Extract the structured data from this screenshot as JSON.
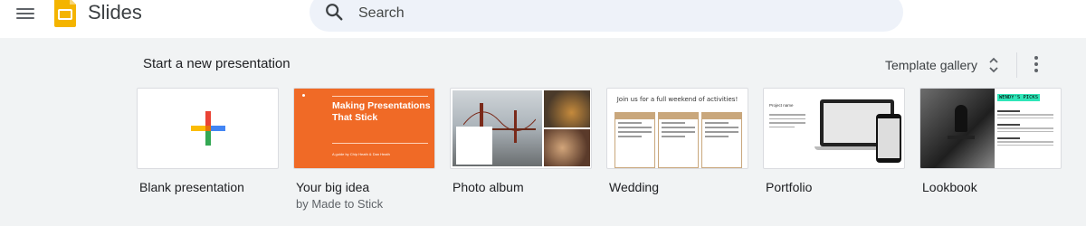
{
  "app": {
    "name": "Slides"
  },
  "search": {
    "placeholder": "Search"
  },
  "start": {
    "section_title": "Start a new presentation",
    "template_gallery_label": "Template gallery"
  },
  "templates": [
    {
      "title": "Blank presentation",
      "subtitle": ""
    },
    {
      "title": "Your big idea",
      "subtitle": "by Made to Stick",
      "thumb_headline": "Making Presentations That Stick",
      "thumb_byline": "A guide by Chip Heath & Dan Heath"
    },
    {
      "title": "Photo album",
      "subtitle": ""
    },
    {
      "title": "Wedding",
      "subtitle": "",
      "thumb_headline": "Join us for a full weekend of activities!"
    },
    {
      "title": "Portfolio",
      "subtitle": "",
      "thumb_headline": "Project name"
    },
    {
      "title": "Lookbook",
      "subtitle": "",
      "thumb_headline": "WENDY'S PICKS"
    }
  ],
  "colors": {
    "slides_yellow": "#f4b400",
    "bigidea_orange": "#f06a26",
    "plus_red": "#ea4335",
    "plus_blue": "#4285f4",
    "plus_green": "#34a853",
    "plus_yellow": "#fbbc04"
  },
  "icons": [
    "menu-icon",
    "slides-logo-icon",
    "search-icon",
    "unfold-icon",
    "more-vert-icon",
    "plus-icon"
  ]
}
